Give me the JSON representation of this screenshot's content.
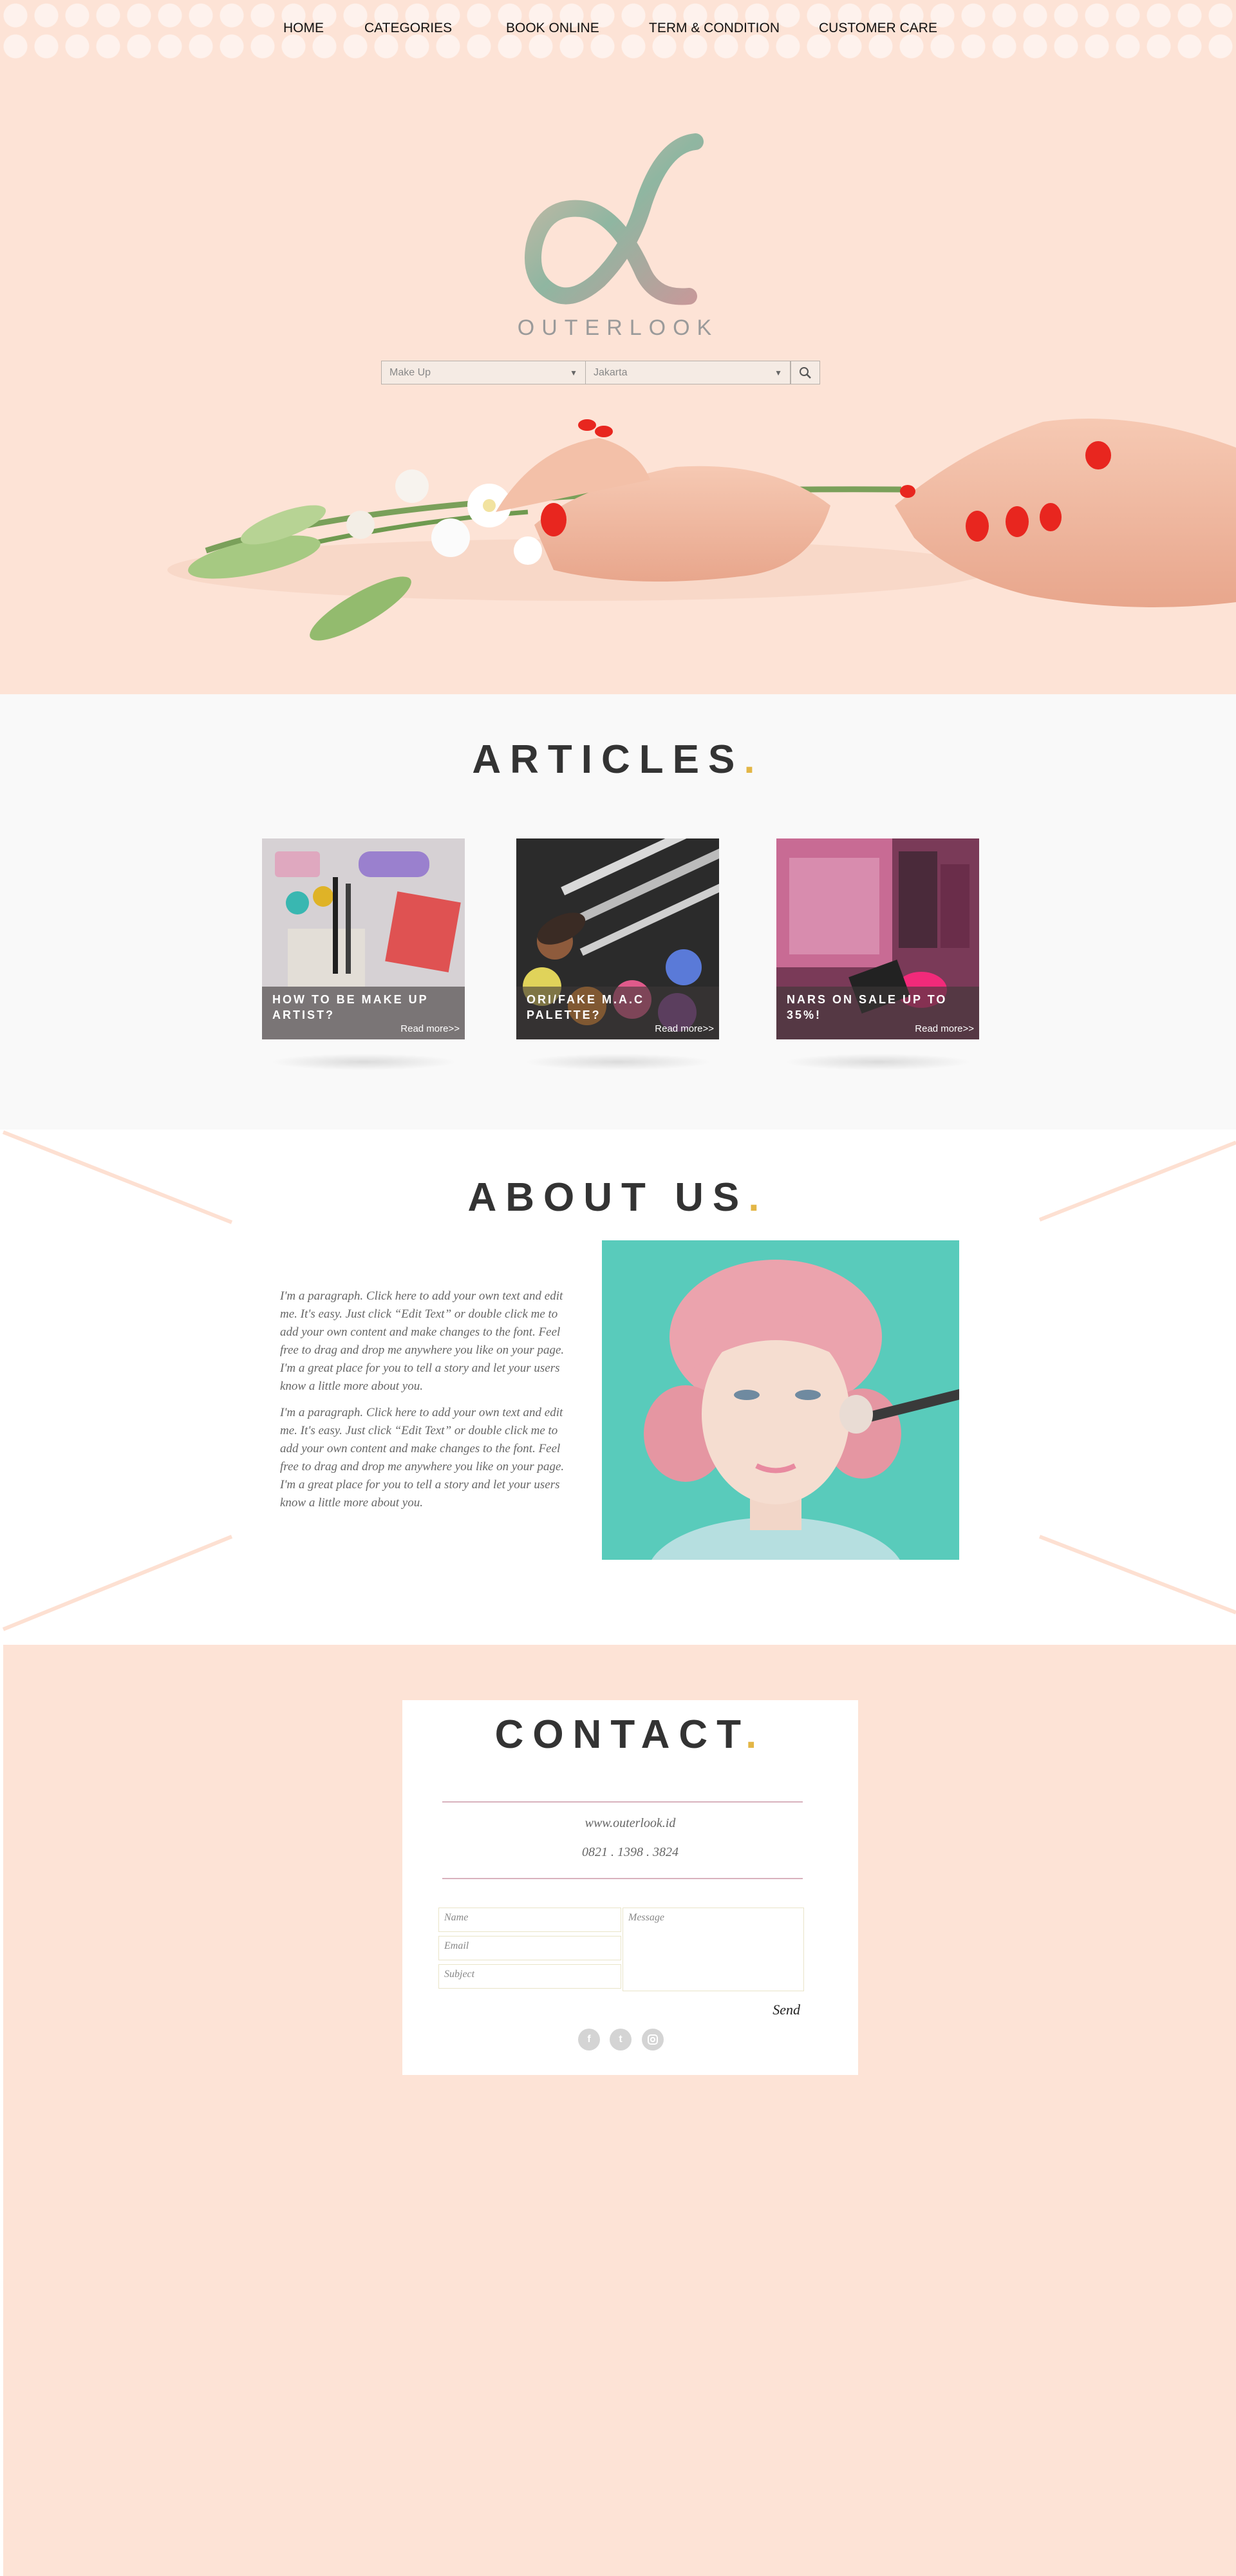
{
  "nav": {
    "items": [
      "HOME",
      "CATEGORIES",
      "BOOK ONLINE",
      "TERM & CONDITION",
      "CUSTOMER CARE"
    ]
  },
  "hero": {
    "brand": "OUTERLOOK",
    "search": {
      "category": "Make Up",
      "location": "Jakarta"
    }
  },
  "articles": {
    "title": "ARTICLES",
    "cards": [
      {
        "title": "HOW TO BE MAKE UP ARTIST?",
        "more": "Read more>>"
      },
      {
        "title": "ORI/FAKE M.A.C PALETTE?",
        "more": "Read more>>"
      },
      {
        "title": "NARS ON SALE UP TO 35%!",
        "more": "Read more>>"
      }
    ]
  },
  "about": {
    "title": "ABOUT US",
    "paragraphs": [
      "I'm a paragraph. Click here to add your own text and edit me. It's easy. Just click “Edit Text” or double click me to add your own content and make changes to the font. Feel free to drag and drop me anywhere you like on your page. I'm a great place for you to tell a story and let your users know a little more about you.",
      "I'm a paragraph. Click here to add your own text and edit me. It's easy. Just click “Edit Text” or double click me to add your own content and make changes to the font. Feel free to drag and drop me anywhere you like on your page. I'm a great place for you to tell a story and let your users know a little more about you."
    ]
  },
  "contact": {
    "title": "CONTACT",
    "website": "www.outerlook.id",
    "phone": "0821 . 1398 . 3824",
    "form": {
      "name_placeholder": "Name",
      "email_placeholder": "Email",
      "subject_placeholder": "Subject",
      "message_placeholder": "Message",
      "send_label": "Send"
    },
    "social": [
      "facebook-icon",
      "twitter-icon",
      "instagram-icon"
    ]
  },
  "colors": {
    "peach": "#fde3d6",
    "accent_dot": "#e3b646",
    "title_text": "#333333",
    "divider": "#d8b2bd"
  }
}
